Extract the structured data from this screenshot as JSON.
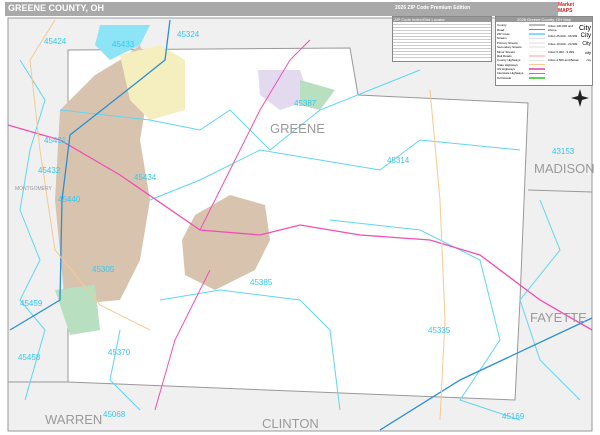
{
  "header": {
    "title": "GREENE COUNTY, OH",
    "edition": "2026 ZIP Code Premium Edition",
    "logo_text": [
      "Market",
      "MAPS"
    ]
  },
  "index": {
    "title": "ZIP Code Index/Grid Locator"
  },
  "legend": {
    "title": "2026 Greene County, OH Map",
    "items": [
      {
        "label": "County",
        "color": "#bbbbbb"
      },
      {
        "label": "Road",
        "color": "#888888"
      },
      {
        "label": "ZIP Code",
        "color": "#7fe0f5"
      },
      {
        "label": "Stream",
        "color": "#dddddd"
      },
      {
        "label": "Primary Streets",
        "color": "#eeeeee"
      },
      {
        "label": "Secondary Streets",
        "color": "#eeeeee"
      },
      {
        "label": "Minor Streets",
        "color": "#f4f4f4"
      },
      {
        "label": "Rail Roads",
        "color": "#f8d0d0"
      },
      {
        "label": "County Highways",
        "color": "#e8e8e8"
      },
      {
        "label": "State Highways",
        "color": "#f7c98f"
      },
      {
        "label": "US Highways",
        "color": "#f06cc0"
      },
      {
        "label": "Interstate Highways",
        "color": "#3ba7e0"
      },
      {
        "label": "Toll Roads",
        "color": "#5dd35d"
      }
    ],
    "cities": [
      {
        "label": "Cities 100,000 and Above",
        "sample": "City"
      },
      {
        "label": "Cities 25,000 - 99,999",
        "sample": "City"
      },
      {
        "label": "Cities 10,000 - 24,999",
        "sample": "City"
      },
      {
        "label": "Cities 5,000 - 9,999",
        "sample": "city"
      },
      {
        "label": "Cities 2,500 and Below",
        "sample": "city"
      }
    ]
  },
  "map": {
    "counties": [
      "GREENE",
      "MADISON",
      "FAYETTE",
      "CLINTON",
      "WARREN",
      "MONTGOMERY"
    ],
    "zips": [
      "45424",
      "45433",
      "45324",
      "45387",
      "45314",
      "43153",
      "45431",
      "45432",
      "45434",
      "45440",
      "45305",
      "45385",
      "45335",
      "45459",
      "45458",
      "45370",
      "45068",
      "45169"
    ],
    "colors": {
      "highway_us": "#f04fb4",
      "interstate": "#2a8fd4",
      "zip_boundary": "#5fd6f2",
      "urban": "#d8c4ae",
      "urban2": "#f5efbf",
      "park": "#b8e0c0",
      "outside": "#f0f0f0"
    }
  }
}
